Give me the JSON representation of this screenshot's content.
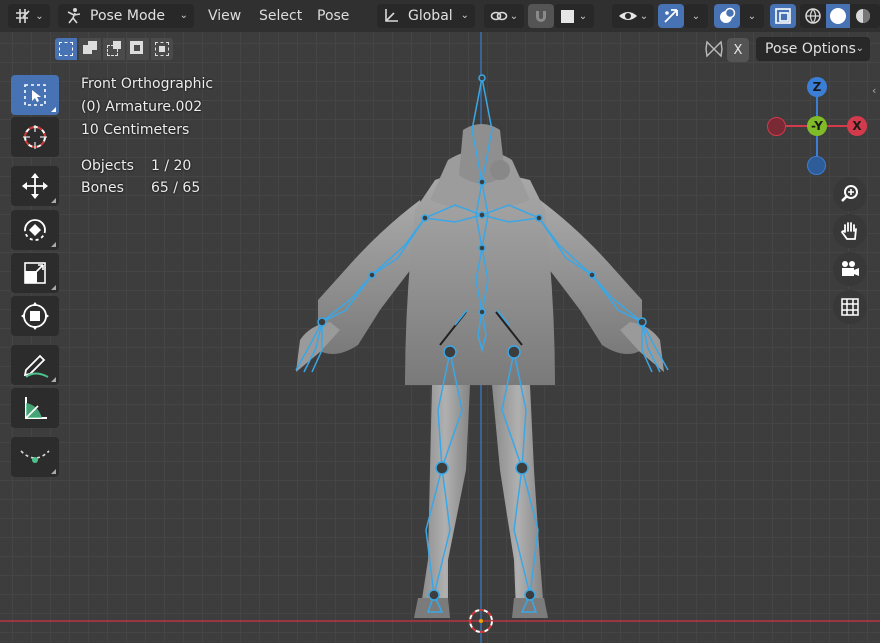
{
  "header": {
    "mode": "Pose Mode",
    "menu": [
      "View",
      "Select",
      "Pose"
    ],
    "transform_orientation": "Global",
    "pose_options": "Pose Options",
    "x_mirror": "X"
  },
  "overlay": {
    "view_name": "Front Orthographic",
    "object_name": "(0) Armature.002",
    "grid_scale": "10 Centimeters",
    "stats": [
      {
        "label": "Objects",
        "value": "1 / 20"
      },
      {
        "label": "Bones",
        "value": "65 / 65"
      }
    ]
  },
  "gizmo": {
    "axes": {
      "z": "Z",
      "y": "-Y",
      "x": "X"
    },
    "colors": {
      "x": "#d33a4c",
      "y": "#7fbc28",
      "z": "#3b7ed6"
    }
  },
  "toolbar": {
    "tools": [
      "select-box-icon",
      "cursor-icon",
      "move-icon",
      "rotate-icon",
      "scale-icon",
      "transform-icon",
      "annotate-icon",
      "measure-icon",
      "relax-pose-icon"
    ]
  },
  "navigation": [
    "zoom-icon",
    "hand-pan-icon",
    "camera-icon",
    "grid-ortho-icon"
  ],
  "colors": {
    "accent": "#4772b3",
    "bone": "#3aa7e6",
    "header": "#303030",
    "viewport": "#3d3d3d"
  }
}
